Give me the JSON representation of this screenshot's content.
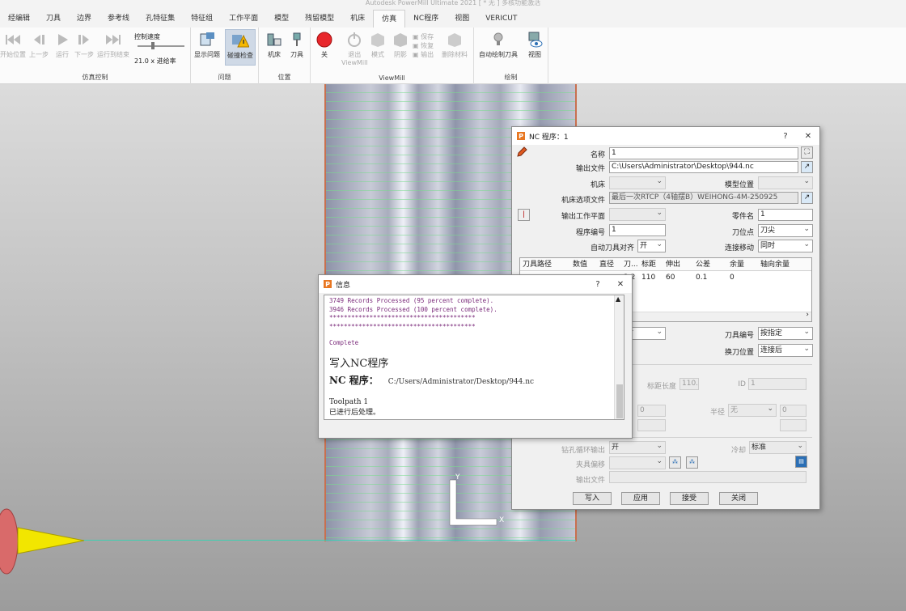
{
  "app": {
    "title": "Autodesk PowerMill Ultimate 2021 [ * 无 ] 多核功能激活"
  },
  "tabs": [
    "经编辑",
    "刀具",
    "边界",
    "参考线",
    "孔特征集",
    "特征组",
    "工作平面",
    "模型",
    "残留模型",
    "机床",
    "仿真",
    "NC程序",
    "视图",
    "VERICUT"
  ],
  "active_tab": "仿真",
  "ribbon": {
    "sim_control": {
      "buttons": [
        "开始位置",
        "上一步",
        "运行",
        "下一步",
        "运行到结束"
      ],
      "speed_label": "控制速度",
      "speed_value": "21.0 x 进给率",
      "group_label": "仿真控制"
    },
    "problems": {
      "buttons": [
        "显示问题",
        "碰撞检查"
      ],
      "group_label": "问题"
    },
    "position": {
      "buttons": [
        "机床",
        "刀具"
      ],
      "group_label": "位置"
    },
    "viewmill": {
      "buttons": [
        "关",
        "退出\nViewMill",
        "模式",
        "阴影",
        "删除材料"
      ],
      "small": [
        "保存",
        "恢复",
        "输出"
      ],
      "group_label": "ViewMill"
    },
    "draw": {
      "buttons": [
        "自动绘制刀具",
        "视图"
      ],
      "group_label": "绘制"
    }
  },
  "nc_dialog": {
    "title": "NC 程序：1",
    "name_label": "名称",
    "name_value": "1",
    "output_file_label": "输出文件",
    "output_file_value": "C:\\Users\\Administrator\\Desktop\\944.nc",
    "machine_label": "机床",
    "model_pos_label": "模型位置",
    "option_file_label": "机床选项文件",
    "option_file_value": "最后一次RTCP（4轴摆B）WEIHONG-4M-250925",
    "output_plane_label": "输出工作平面",
    "part_name_label": "零件名",
    "part_name_value": "1",
    "program_no_label": "程序编号",
    "program_no_value": "1",
    "tool_point_label": "刀位点",
    "tool_point_value": "刀尖",
    "auto_align_label": "自动刀具对齐",
    "auto_align_value": "开",
    "connect_label": "连接移动",
    "connect_value": "同时",
    "table": {
      "headers": [
        "刀具路径",
        "数值",
        "直径",
        "刀...",
        "标距",
        "伸出",
        "公差",
        "余量",
        "轴向余量"
      ],
      "row": [
        "",
        "",
        "",
        "2.2",
        "110",
        "60",
        "0.1",
        "0",
        ""
      ]
    },
    "combo_partial": "时",
    "tool_no_label": "刀具编号",
    "tool_no_value": "按指定",
    "tool_change_label": "换刀位置",
    "tool_change_value": "连接后",
    "gauge_label": "标距长度",
    "gauge_value": "110.0",
    "id_label": "ID",
    "id_value": "1",
    "zero_left": "0",
    "radius_label": "半径",
    "radius_value": "无",
    "radius_num": "0",
    "drill_label": "钻孔循环输出",
    "drill_value": "开",
    "coolant_label": "冷却",
    "coolant_value": "标准",
    "fixture_label": "夹具偏移",
    "output_file2_label": "输出文件",
    "buttons": [
      "写入",
      "应用",
      "接受",
      "关闭"
    ]
  },
  "info_dialog": {
    "title": "信息",
    "log_lines": [
      "3749 Records Processed (95 percent complete).",
      "3946 Records Processed (100 percent complete).",
      "****************************************",
      "****************************************",
      "",
      "Complete"
    ],
    "heading": "写入NC程序",
    "nc_label": "NC 程序：",
    "nc_path": "C:/Users/Administrator/Desktop/944.nc",
    "toolpath": "Toolpath 1",
    "done": "已进行后处理。"
  },
  "axis": {
    "y": "Y",
    "x": "X"
  },
  "colors": {
    "accent": "#e87722",
    "stop_red": "#e8262b",
    "tool_yellow": "#f2e600",
    "holder_red": "#d96a6a"
  }
}
